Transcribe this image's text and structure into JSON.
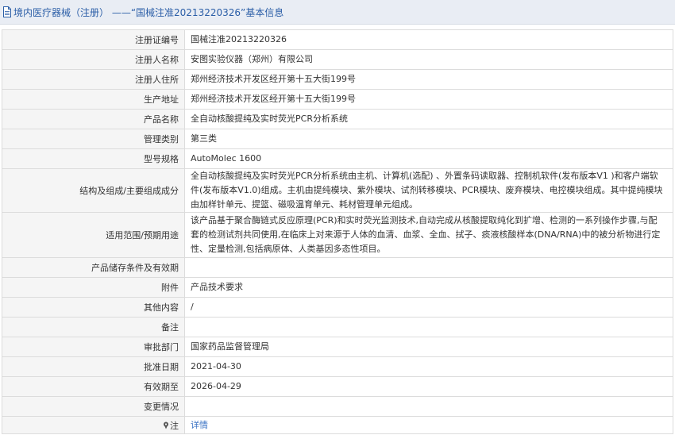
{
  "header": {
    "title": "境内医疗器械（注册） ——“国械注准20213220326”基本信息"
  },
  "rows": [
    {
      "label": "注册证编号",
      "value": "国械注准20213220326"
    },
    {
      "label": "注册人名称",
      "value": "安图实验仪器（郑州）有限公司"
    },
    {
      "label": "注册人住所",
      "value": "郑州经济技术开发区经开第十五大街199号"
    },
    {
      "label": "生产地址",
      "value": "郑州经济技术开发区经开第十五大街199号"
    },
    {
      "label": "产品名称",
      "value": "全自动核酸提纯及实时荧光PCR分析系统"
    },
    {
      "label": "管理类别",
      "value": "第三类"
    },
    {
      "label": "型号规格",
      "value": "AutoMolec 1600"
    },
    {
      "label": "结构及组成/主要组成成分",
      "value": "全自动核酸提纯及实时荧光PCR分析系统由主机、计算机(选配) 、外置条码读取器、控制机软件(发布版本V1 )和客户端软件(发布版本V1.0)组成。主机由提纯模块、紫外模块、试剂转移模块、PCR模块、废弃模块、电控模块组成。其中提纯模块由加样针单元、提篮、磁吸温育单元、耗材管理单元组成。"
    },
    {
      "label": "适用范围/预期用途",
      "value": "该产品基于聚合酶链式反应原理(PCR)和实时荧光监测技术,自动完成从核酸提取纯化到扩增、检测的一系列操作步骤,与配套的检测试剂共同使用,在临床上对来源于人体的血清、血浆、全血、拭子、痰液核酸样本(DNA/RNA)中的被分析物进行定性、定量检测,包括病原体、人类基因多态性项目。"
    },
    {
      "label": "产品储存条件及有效期",
      "value": ""
    },
    {
      "label": "附件",
      "value": "产品技术要求"
    },
    {
      "label": "其他内容",
      "value": "/"
    },
    {
      "label": "备注",
      "value": ""
    },
    {
      "label": "审批部门",
      "value": "国家药品监督管理局"
    },
    {
      "label": "批准日期",
      "value": "2021-04-30"
    },
    {
      "label": "有效期至",
      "value": "2026-04-29"
    },
    {
      "label": "变更情况",
      "value": ""
    }
  ],
  "footer_row": {
    "label": "注",
    "link_text": "详情"
  },
  "colors": {
    "title": "#2b5ea7",
    "link": "#3b73c4",
    "label_bg": "#f5f5f5",
    "header_bg": "#e9edf4"
  }
}
